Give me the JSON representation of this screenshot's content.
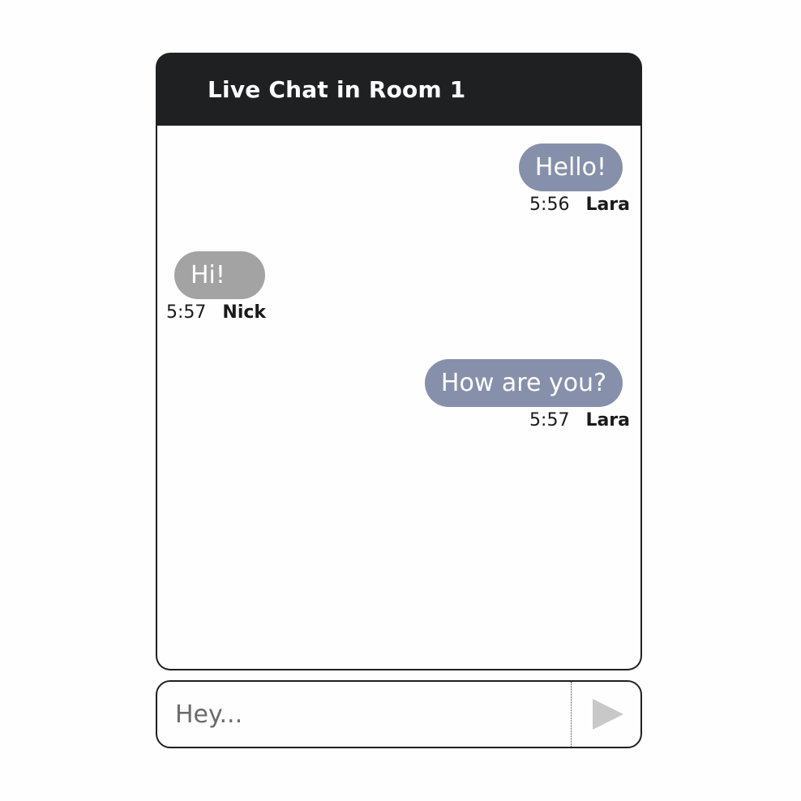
{
  "header": {
    "title": "Live Chat in Room 1"
  },
  "messages": [
    {
      "text": "Hello!",
      "time": "5:56",
      "author": "Lara",
      "side": "right"
    },
    {
      "text": "Hi!",
      "time": "5:57",
      "author": "Nick",
      "side": "left"
    },
    {
      "text": "How are you?",
      "time": "5:57",
      "author": "Lara",
      "side": "right"
    }
  ],
  "composer": {
    "placeholder": "Hey...",
    "value": ""
  },
  "icons": {
    "send": "send-icon"
  },
  "colors": {
    "header_bg": "#1f2022",
    "own_bubble": "#8790aa",
    "other_bubble": "#a3a3a3",
    "send_icon": "#c8c8c8"
  }
}
